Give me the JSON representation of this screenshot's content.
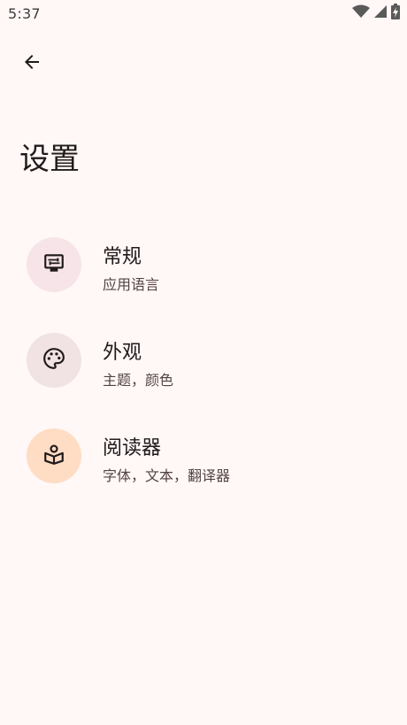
{
  "status_bar": {
    "time": "5:37",
    "icons": [
      "wifi-icon",
      "cellular-signal-icon",
      "battery-charging-icon"
    ]
  },
  "app_bar": {
    "back_icon": "arrow-back-icon"
  },
  "page": {
    "title": "设置"
  },
  "settings": {
    "items": [
      {
        "id": "general",
        "title": "常规",
        "subtitle": "应用语言",
        "icon": "display-settings-icon",
        "icon_bg": "#f6e4e8"
      },
      {
        "id": "appearance",
        "title": "外观",
        "subtitle": "主题，颜色",
        "icon": "palette-icon",
        "icon_bg": "#f1e2e4"
      },
      {
        "id": "reader",
        "title": "阅读器",
        "subtitle": "字体，文本，翻译器",
        "icon": "local-library-icon",
        "icon_bg": "#ffdcc4"
      }
    ]
  },
  "colors": {
    "background": "#fff8f7",
    "text_primary": "#201a1a",
    "text_secondary": "#534343"
  }
}
